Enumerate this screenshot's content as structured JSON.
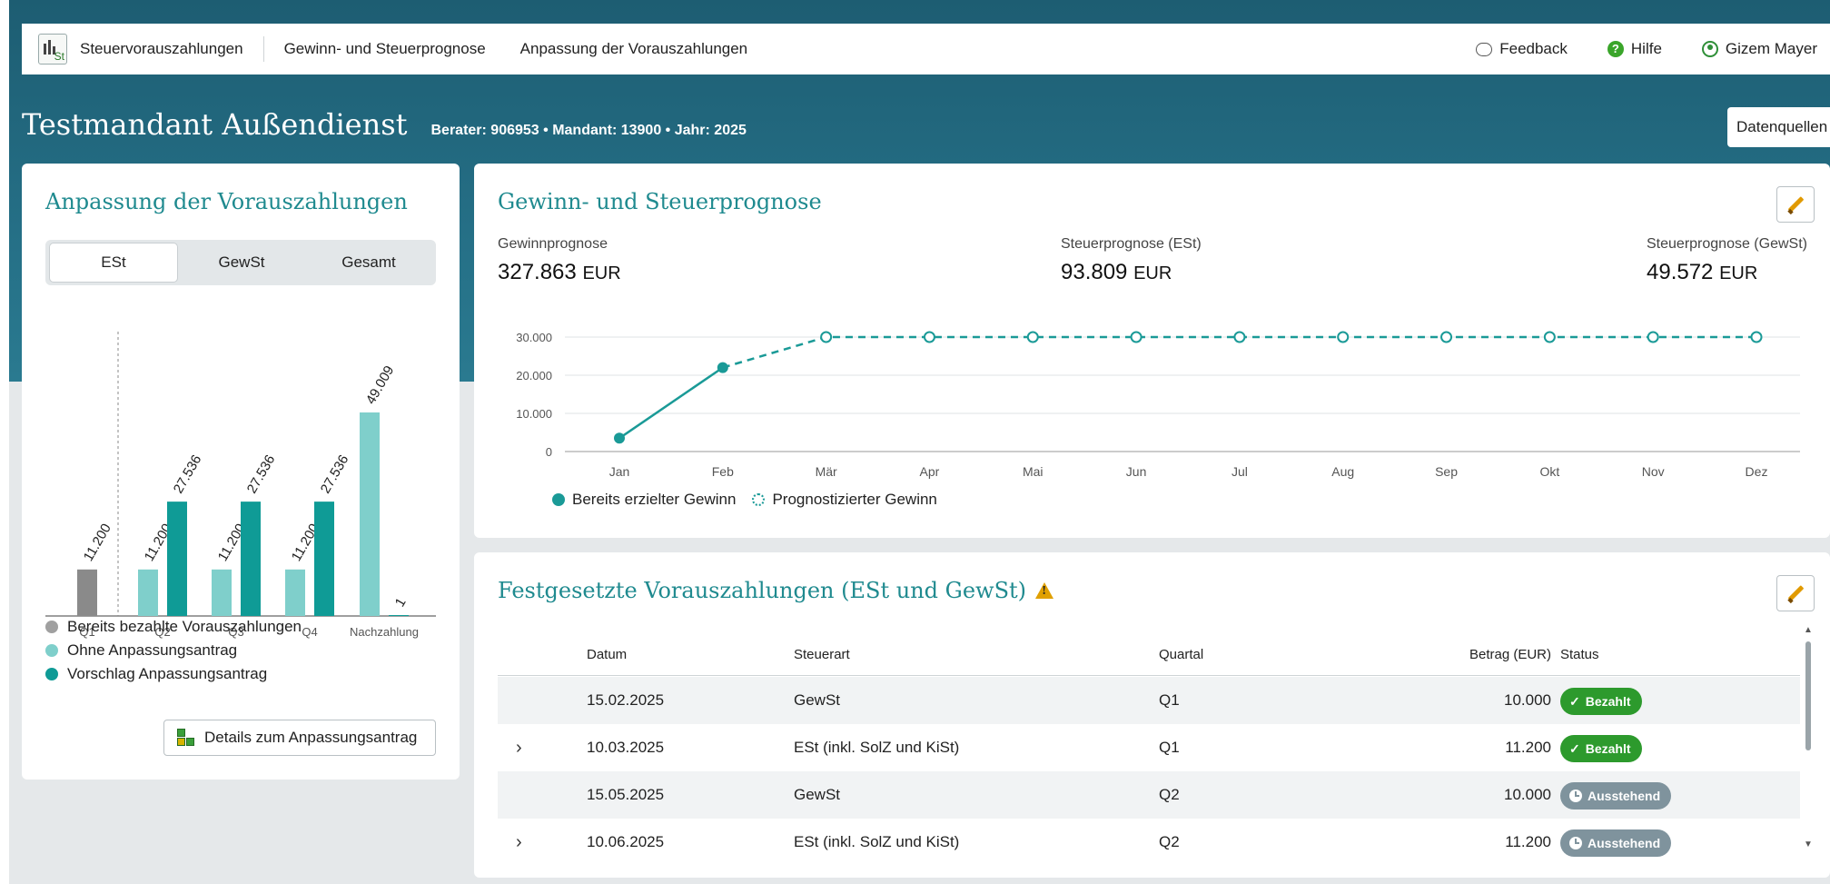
{
  "nav": {
    "app_name": "Steuervorauszahlungen",
    "items": [
      "Gewinn- und Steuerprognose",
      "Anpassung der Vorauszahlungen"
    ],
    "feedback": "Feedback",
    "help": "Hilfe",
    "user": "Gizem Mayer"
  },
  "header": {
    "title": "Testmandant Außendienst",
    "meta": "Berater: 906953 • Mandant: 13900 • Jahr: 2025",
    "datasources_button": "Datenquellen"
  },
  "adjustment": {
    "title": "Anpassung der Vorauszahlungen",
    "tabs": [
      "ESt",
      "GewSt",
      "Gesamt"
    ],
    "active_tab": "ESt",
    "legend": [
      "Bereits bezahlte Vorauszahlungen",
      "Ohne Anpassungsantrag",
      "Vorschlag Anpassungsantrag"
    ],
    "details_button": "Details zum Anpassungsantrag",
    "colors": {
      "paid": "#8a8a8a",
      "without": "#7fcfcb",
      "proposal": "#0f9b96"
    }
  },
  "chart_data": [
    {
      "type": "bar",
      "categories": [
        "Q1",
        "Q2",
        "Q3",
        "Q4",
        "Nachzahlung"
      ],
      "series": [
        {
          "name": "Bereits bezahlte Vorauszahlungen",
          "values": [
            11200,
            null,
            null,
            null,
            null
          ],
          "labels": [
            "11.200",
            "",
            "",
            "",
            ""
          ]
        },
        {
          "name": "Ohne Anpassungsantrag",
          "values": [
            null,
            11200,
            11200,
            11200,
            49009
          ],
          "labels": [
            "",
            "11.200",
            "11.200",
            "11.200",
            "49.009"
          ]
        },
        {
          "name": "Vorschlag Anpassungsantrag",
          "values": [
            null,
            27536,
            27536,
            27536,
            1
          ],
          "labels": [
            "",
            "27.536",
            "27.536",
            "27.536",
            "1"
          ]
        }
      ],
      "ylim": [
        0,
        70000
      ]
    },
    {
      "type": "line",
      "x": [
        "Jan",
        "Feb",
        "Mär",
        "Apr",
        "Mai",
        "Jun",
        "Jul",
        "Aug",
        "Sep",
        "Okt",
        "Nov",
        "Dez"
      ],
      "series": [
        {
          "name": "Bereits erzielter Gewinn",
          "values": [
            3500,
            22000,
            null,
            null,
            null,
            null,
            null,
            null,
            null,
            null,
            null,
            null
          ]
        },
        {
          "name": "Prognostizierter Gewinn",
          "values": [
            null,
            22000,
            30000,
            30000,
            30000,
            30000,
            30000,
            30000,
            30000,
            30000,
            30000,
            30000
          ]
        }
      ],
      "yticks": [
        "0",
        "10.000",
        "20.000",
        "30.000"
      ],
      "ylim": [
        0,
        30000
      ],
      "grid": true
    }
  ],
  "forecast": {
    "title": "Gewinn- und Steuerprognose",
    "kpis": [
      {
        "label": "Gewinnprognose",
        "value": "327.863",
        "unit": "EUR"
      },
      {
        "label": "Steuerprognose (ESt)",
        "value": "93.809",
        "unit": "EUR"
      },
      {
        "label": "Steuerprognose (GewSt)",
        "value": "49.572",
        "unit": "EUR"
      }
    ],
    "legend": [
      "Bereits erzielter Gewinn",
      "Prognostizierter Gewinn"
    ],
    "line_color": "#1a9a97"
  },
  "payments": {
    "title": "Festgesetzte Vorauszahlungen (ESt und GewSt)",
    "headers": [
      "Datum",
      "Steuerart",
      "Quartal",
      "Betrag (EUR)",
      "Status"
    ],
    "rows": [
      {
        "expand": "",
        "date": "15.02.2025",
        "type": "GewSt",
        "quarter": "Q1",
        "amount": "10.000",
        "status": "Bezahlt"
      },
      {
        "expand": "›",
        "date": "10.03.2025",
        "type": "ESt (inkl. SolZ und KiSt)",
        "quarter": "Q1",
        "amount": "11.200",
        "status": "Bezahlt"
      },
      {
        "expand": "",
        "date": "15.05.2025",
        "type": "GewSt",
        "quarter": "Q2",
        "amount": "10.000",
        "status": "Ausstehend"
      },
      {
        "expand": "›",
        "date": "10.06.2025",
        "type": "ESt (inkl. SolZ und KiSt)",
        "quarter": "Q2",
        "amount": "11.200",
        "status": "Ausstehend"
      }
    ]
  }
}
